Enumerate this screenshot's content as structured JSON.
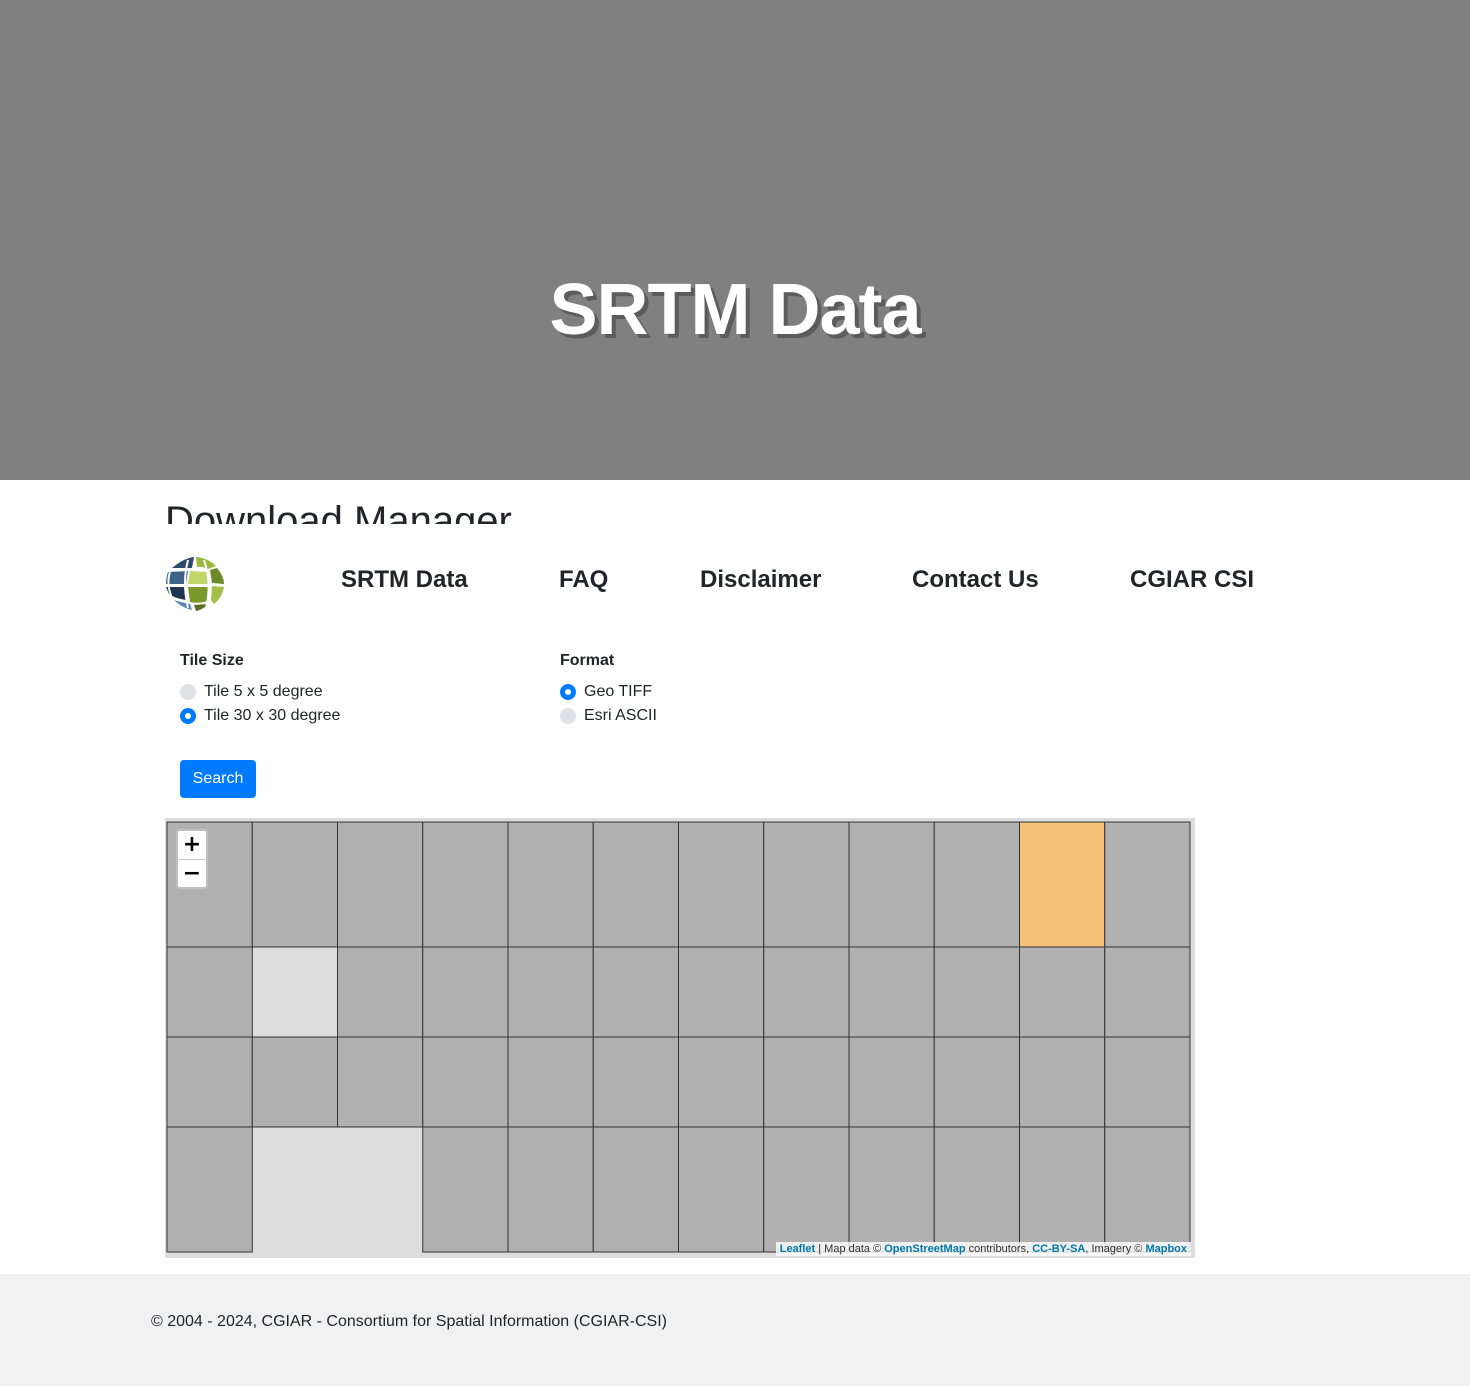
{
  "hero": {
    "title": "SRTM Data"
  },
  "section_title": "Download Manager",
  "nav": {
    "items": [
      {
        "label": "SRTM Data"
      },
      {
        "label": "FAQ"
      },
      {
        "label": "Disclaimer"
      },
      {
        "label": "Contact Us"
      },
      {
        "label": "CGIAR CSI"
      }
    ]
  },
  "form": {
    "tile_size": {
      "label": "Tile Size",
      "options": [
        {
          "label": "Tile 5 x 5 degree",
          "checked": false
        },
        {
          "label": "Tile 30 x 30 degree",
          "checked": true
        }
      ]
    },
    "format": {
      "label": "Format",
      "options": [
        {
          "label": "Geo TIFF",
          "checked": true
        },
        {
          "label": "Esri ASCII",
          "checked": false
        }
      ]
    },
    "search_label": "Search"
  },
  "map": {
    "zoom_in": "+",
    "zoom_out": "−",
    "attribution": {
      "leaflet": "Leaflet",
      "sep": " | Map data © ",
      "osm": "OpenStreetMap",
      "contrib": " contributors, ",
      "license": "CC-BY-SA",
      "imagery": ", Imagery © ",
      "mapbox": "Mapbox"
    },
    "tile_fill": "#b0b0b0",
    "highlight_fill": "#f3c277",
    "empty_fill": "#dddddd"
  },
  "footer": {
    "text": "© 2004 - 2024, CGIAR - Consortium for Spatial Information (CGIAR-CSI)"
  }
}
